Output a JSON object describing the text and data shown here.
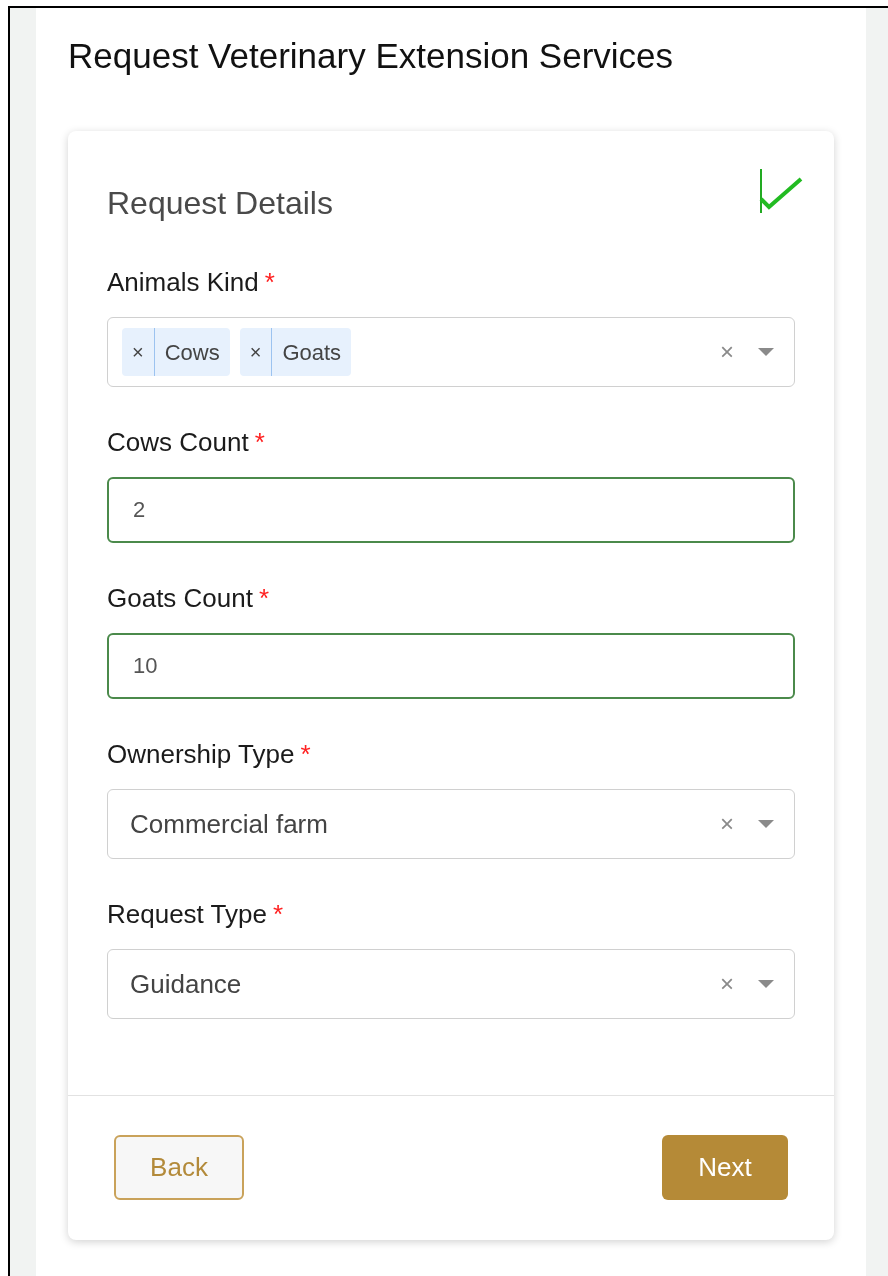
{
  "page_title": "Request Veterinary Extension Services",
  "section": {
    "title": "Request Details",
    "completed": true
  },
  "fields": [
    {
      "kind": "multiselect",
      "label": "Animals Kind",
      "required_mark": "*",
      "tags": [
        "Cows",
        "Goats"
      ],
      "tag_remove": "×",
      "clear": "×"
    },
    {
      "kind": "input",
      "label": "Cows Count",
      "required_mark": "*",
      "value": "2",
      "valid": true
    },
    {
      "kind": "input",
      "label": "Goats Count",
      "required_mark": "*",
      "value": "10",
      "valid": true
    },
    {
      "kind": "select",
      "label": "Ownership Type",
      "required_mark": "*",
      "value": "Commercial farm",
      "clear": "×"
    },
    {
      "kind": "select",
      "label": "Request Type",
      "required_mark": "*",
      "value": "Guidance",
      "clear": "×"
    }
  ],
  "buttons": {
    "back": "Back",
    "next": "Next"
  }
}
